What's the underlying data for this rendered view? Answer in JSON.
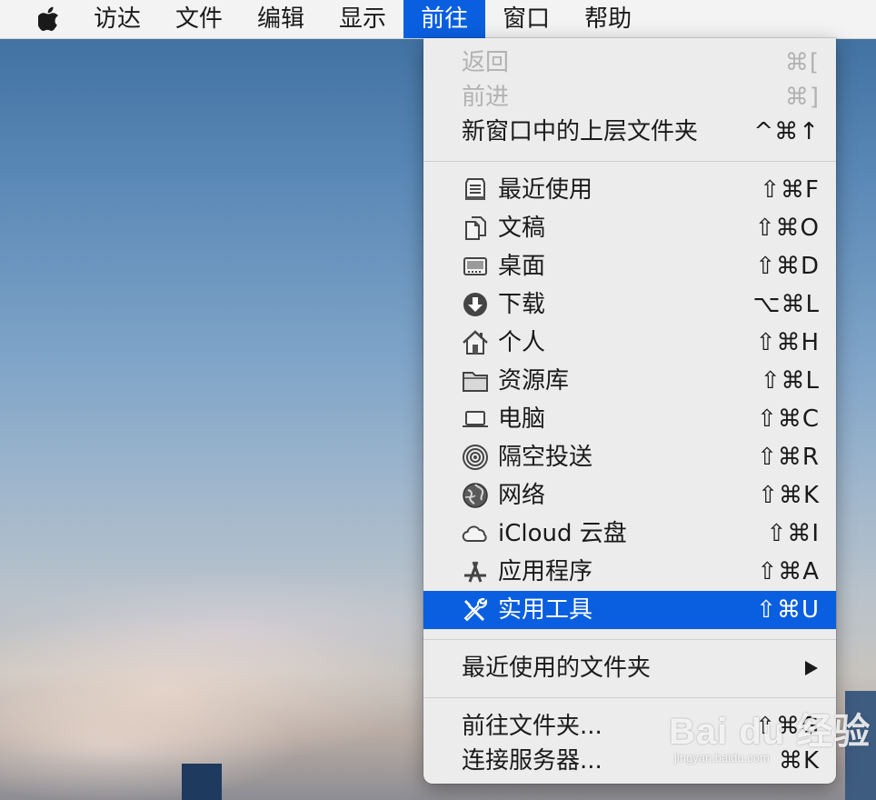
{
  "menubar": {
    "apple_icon": "apple-logo",
    "items": [
      "访达",
      "文件",
      "编辑",
      "显示",
      "前往",
      "窗口",
      "帮助"
    ],
    "active": "前往"
  },
  "go_menu": {
    "back": {
      "label": "返回",
      "shortcut": "⌘[",
      "enabled": false
    },
    "forward": {
      "label": "前进",
      "shortcut": "⌘]",
      "enabled": false
    },
    "enclosing": {
      "label": "新窗口中的上层文件夹",
      "shortcut": "^⌘↑"
    },
    "places": [
      {
        "label": "最近使用",
        "shortcut": "⇧⌘F",
        "icon": "recents-icon"
      },
      {
        "label": "文稿",
        "shortcut": "⇧⌘O",
        "icon": "documents-icon"
      },
      {
        "label": "桌面",
        "shortcut": "⇧⌘D",
        "icon": "desktop-icon"
      },
      {
        "label": "下载",
        "shortcut": "⌥⌘L",
        "icon": "downloads-icon"
      },
      {
        "label": "个人",
        "shortcut": "⇧⌘H",
        "icon": "home-icon"
      },
      {
        "label": "资源库",
        "shortcut": "⇧⌘L",
        "icon": "folder-icon"
      },
      {
        "label": "电脑",
        "shortcut": "⇧⌘C",
        "icon": "computer-icon"
      },
      {
        "label": "隔空投送",
        "shortcut": "⇧⌘R",
        "icon": "airdrop-icon"
      },
      {
        "label": "网络",
        "shortcut": "⇧⌘K",
        "icon": "network-icon"
      },
      {
        "label": "iCloud 云盘",
        "shortcut": "⇧⌘I",
        "icon": "icloud-icon"
      },
      {
        "label": "应用程序",
        "shortcut": "⇧⌘A",
        "icon": "applications-icon"
      },
      {
        "label": "实用工具",
        "shortcut": "⇧⌘U",
        "icon": "utilities-icon",
        "highlighted": true
      }
    ],
    "recent_folders": {
      "label": "最近使用的文件夹",
      "has_submenu": true
    },
    "goto_folder": {
      "label": "前往文件夹...",
      "shortcut": "⇧⌘G"
    },
    "connect_server": {
      "label": "连接服务器...",
      "shortcut": "⌘K"
    }
  },
  "colors": {
    "highlight": "#0a5fe0",
    "menu_bg": "#ececec",
    "disabled_text": "#b2b2b2"
  },
  "watermark": {
    "logo": "Bai du 经验",
    "url": "jingyan.baidu.com"
  }
}
